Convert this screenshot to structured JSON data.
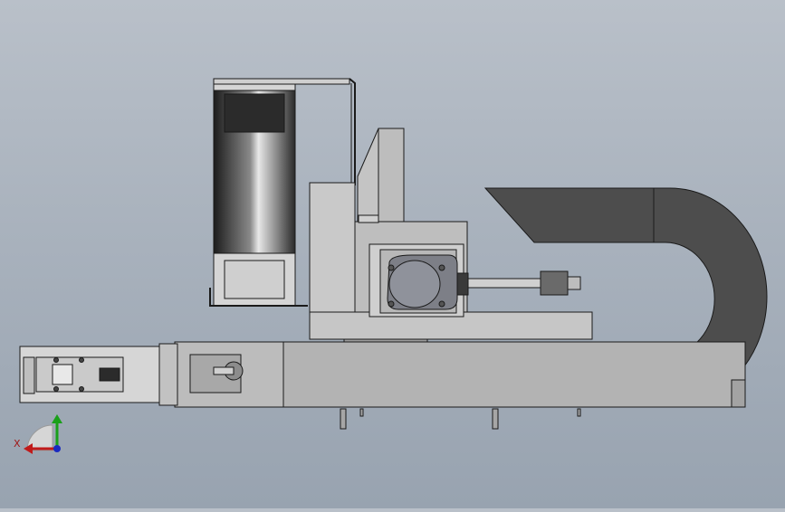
{
  "viewport": {
    "background_top": "#b9c0c9",
    "background_bottom": "#98a3b0"
  },
  "model": {
    "body_color": "#bfbfbf",
    "dark_color": "#4d4d4d",
    "edge_color": "#1a1a1a",
    "motor_color": "#7d7f87"
  },
  "triad": {
    "x_label": "X",
    "x_color": "#c01a1a",
    "y_color": "#1aa01a",
    "z_color": "#1a2ac0",
    "icon": "axis-triad-icon"
  }
}
